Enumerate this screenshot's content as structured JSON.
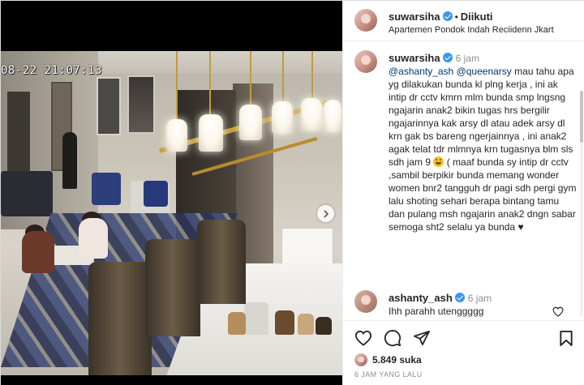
{
  "post": {
    "username": "suwarsiha",
    "follow_status": "Diikuti",
    "location": "Apartemen Pondok Indah Reciidenn Jkart",
    "cctv_timestamp": "08-22 21:07:13"
  },
  "caption": {
    "username": "suwarsiha",
    "time": "6 jam",
    "mention_1": "@ashanty_ash",
    "mention_2": "@queenarsy",
    "text_1": "mau tahu apa yg dilakukan bunda kl plng kerja , ini ak intip dr cctv kmrn mlm bunda smp lngsng ngajarin anak2 bikin tugas hrs bergilir ngajarinnya kak arsy dl atau adek arsy dl krn gak bs bareng ngerjainnya , ini anak2 agak telat tdr mlmnya krn tugasnya blm sls sdh jam 9",
    "text_2": "( maaf bunda sy intip dr cctv ,sambil berpikir bunda memang wonder women bnr2 tangguh dr pagi sdh pergi gym lalu shoting sehari berapa bintang tamu dan pulang msh ngajarin anak2 dngn sabar semoga sht2 selalu ya bunda ♥"
  },
  "comment": {
    "username": "ashanty_ash",
    "time": "6 jam",
    "text": "Ihh parahh utenggggg"
  },
  "likes": {
    "count_label": "5.849 suka",
    "time_ago": "6 JAM YANG LALU"
  },
  "icons": {
    "verified": "verified-badge-icon",
    "like": "heart-icon",
    "comment": "comment-icon",
    "share": "share-icon",
    "save": "bookmark-icon",
    "next": "chevron-right-icon"
  },
  "colors": {
    "verified": "#3897f0",
    "mention": "#00376b",
    "secondary_text": "#8e8e8e"
  }
}
